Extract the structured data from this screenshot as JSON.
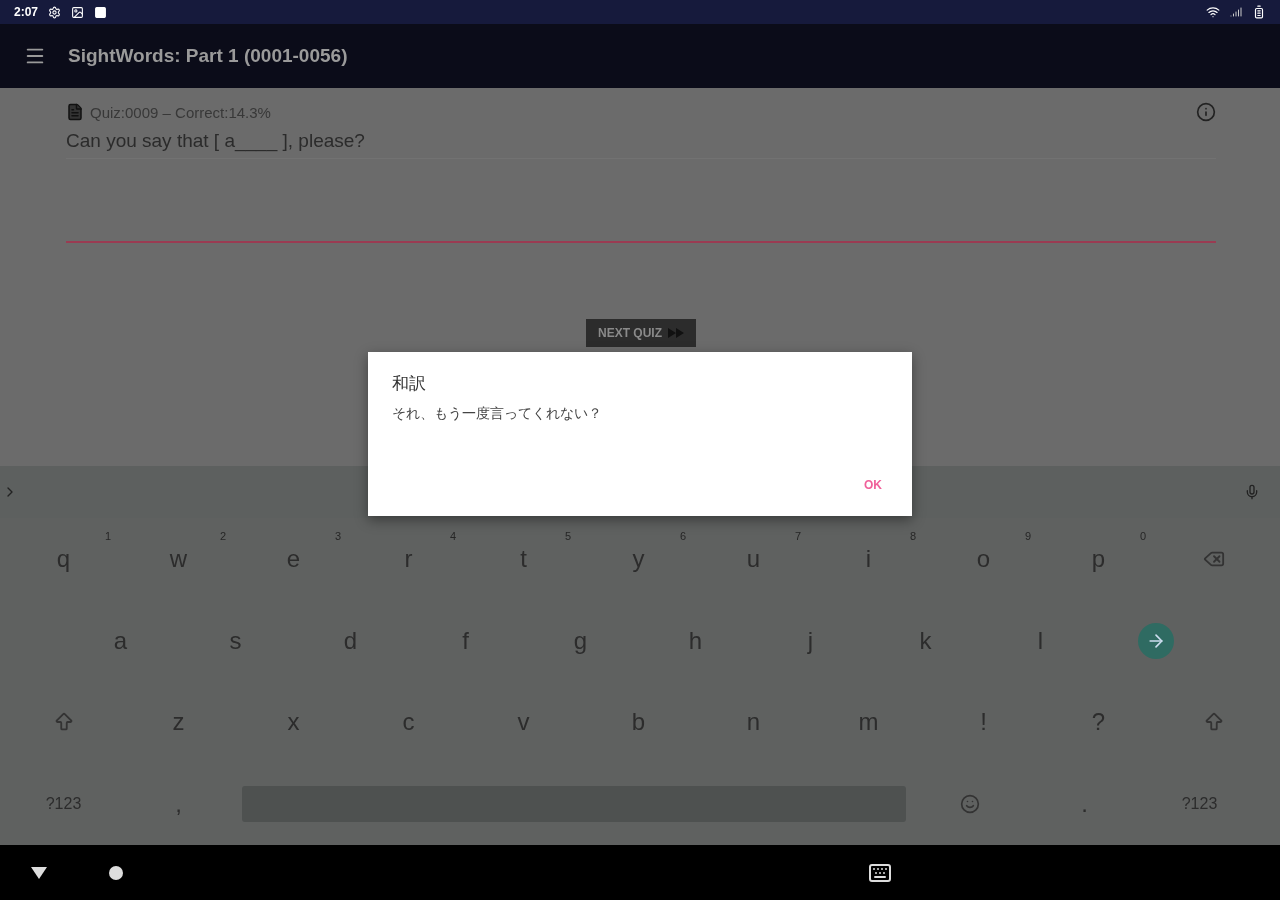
{
  "status_bar": {
    "time": "2:07"
  },
  "app_bar": {
    "title": "SightWords: Part 1 (0001-0056)"
  },
  "quiz": {
    "header": "Quiz:0009  – Correct:14.3%",
    "question": "Can you say that [ a____ ], please?",
    "next_button": "NEXT QUIZ"
  },
  "dialog": {
    "title": "和訳",
    "message": "それ、もう一度言ってくれない？",
    "button": "OK"
  },
  "keyboard": {
    "rows": [
      [
        {
          "kind": "letter",
          "label": "q",
          "hint": "1"
        },
        {
          "kind": "letter",
          "label": "w",
          "hint": "2"
        },
        {
          "kind": "letter",
          "label": "e",
          "hint": "3"
        },
        {
          "kind": "letter",
          "label": "r",
          "hint": "4"
        },
        {
          "kind": "letter",
          "label": "t",
          "hint": "5"
        },
        {
          "kind": "letter",
          "label": "y",
          "hint": "6"
        },
        {
          "kind": "letter",
          "label": "u",
          "hint": "7"
        },
        {
          "kind": "letter",
          "label": "i",
          "hint": "8"
        },
        {
          "kind": "letter",
          "label": "o",
          "hint": "9"
        },
        {
          "kind": "letter",
          "label": "p",
          "hint": "0"
        },
        {
          "kind": "backspace"
        }
      ],
      [
        {
          "kind": "letter",
          "label": "a"
        },
        {
          "kind": "letter",
          "label": "s"
        },
        {
          "kind": "letter",
          "label": "d"
        },
        {
          "kind": "letter",
          "label": "f"
        },
        {
          "kind": "letter",
          "label": "g"
        },
        {
          "kind": "letter",
          "label": "h"
        },
        {
          "kind": "letter",
          "label": "j"
        },
        {
          "kind": "letter",
          "label": "k"
        },
        {
          "kind": "letter",
          "label": "l"
        },
        {
          "kind": "enter"
        }
      ],
      [
        {
          "kind": "shift"
        },
        {
          "kind": "letter",
          "label": "z"
        },
        {
          "kind": "letter",
          "label": "x"
        },
        {
          "kind": "letter",
          "label": "c"
        },
        {
          "kind": "letter",
          "label": "v"
        },
        {
          "kind": "letter",
          "label": "b"
        },
        {
          "kind": "letter",
          "label": "n"
        },
        {
          "kind": "letter",
          "label": "m"
        },
        {
          "kind": "letter",
          "label": "!"
        },
        {
          "kind": "letter",
          "label": "?"
        },
        {
          "kind": "shift"
        }
      ],
      [
        {
          "kind": "symbols",
          "label": "?123"
        },
        {
          "kind": "letter",
          "label": ","
        },
        {
          "kind": "space"
        },
        {
          "kind": "emoji"
        },
        {
          "kind": "letter",
          "label": "."
        },
        {
          "kind": "symbols",
          "label": "?123"
        }
      ]
    ]
  }
}
